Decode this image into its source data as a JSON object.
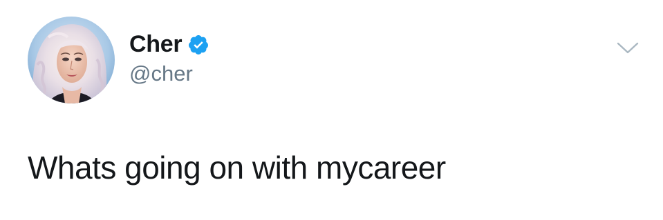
{
  "tweet": {
    "author": {
      "display_name": "Cher",
      "handle": "@cher",
      "verified": true,
      "avatar": "profile-photo"
    },
    "text": "Whats going on with mycareer",
    "menu_icon": "chevron-down-icon"
  },
  "colors": {
    "name_text": "#14171a",
    "handle_text": "#657786",
    "verified_blue": "#1da1f2",
    "caret": "#aab8c2",
    "background": "#ffffff"
  }
}
